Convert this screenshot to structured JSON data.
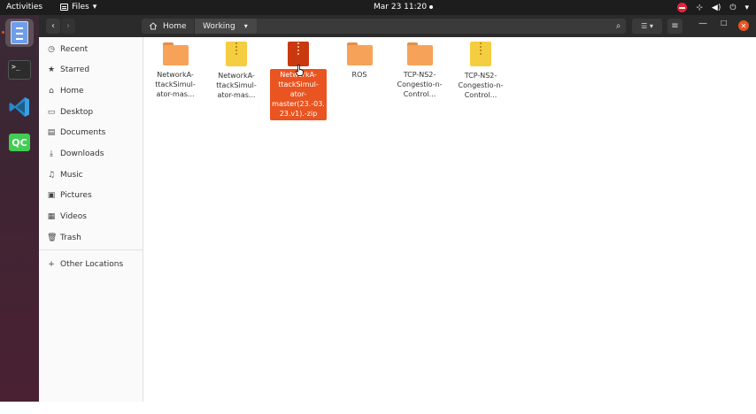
{
  "topbar": {
    "activities": "Activities",
    "app_name": "Files",
    "app_menu_arrow": "▾",
    "clock": "Mar 23  11:20",
    "tray_network": "⊹",
    "tray_volume": "◀)",
    "tray_power": "⏻",
    "tray_menu_arrow": "▾"
  },
  "dock": {
    "apps": [
      {
        "name": "Files",
        "icon": "files-icon"
      },
      {
        "name": "Terminal",
        "icon": "terminal-icon",
        "glyph": ">_"
      },
      {
        "name": "Visual Studio Code",
        "icon": "vscode-icon"
      },
      {
        "name": "Qt Creator",
        "icon": "qt-creator-icon",
        "glyph": "QC"
      }
    ],
    "show_apps_glyph": "···"
  },
  "header": {
    "back_glyph": "‹",
    "forward_glyph": "›",
    "path": [
      "Home",
      "Working"
    ],
    "path_arrow": "▾",
    "search_glyph": "⌕",
    "view_glyph": "☰ ▾",
    "menu_glyph": "≡",
    "minimize_glyph": "—",
    "maximize_glyph": "□",
    "close_glyph": "✕"
  },
  "sidebar": {
    "items": [
      {
        "label": "Recent",
        "icon": "clock-icon",
        "glyph": "◷"
      },
      {
        "label": "Starred",
        "icon": "star-icon",
        "glyph": "★"
      },
      {
        "label": "Home",
        "icon": "home-icon",
        "glyph": "⌂"
      },
      {
        "label": "Desktop",
        "icon": "desktop-icon",
        "glyph": "▭"
      },
      {
        "label": "Documents",
        "icon": "documents-icon",
        "glyph": "▤"
      },
      {
        "label": "Downloads",
        "icon": "downloads-icon",
        "glyph": "⤓"
      },
      {
        "label": "Music",
        "icon": "music-icon",
        "glyph": "♫"
      },
      {
        "label": "Pictures",
        "icon": "pictures-icon",
        "glyph": "▣"
      },
      {
        "label": "Videos",
        "icon": "videos-icon",
        "glyph": "▦"
      },
      {
        "label": "Trash",
        "icon": "trash-icon",
        "glyph": "🗑"
      }
    ],
    "other_locations": {
      "label": "Other Locations",
      "glyph": "+"
    }
  },
  "files": [
    {
      "label": "NetworkA-ttackSimul-ator-mas...",
      "type": "folder",
      "selected": false
    },
    {
      "label": "NetworkA-ttackSimul-ator-mas...",
      "type": "zip",
      "selected": false
    },
    {
      "label": "NetworkA-ttackSimul-ator-master(23.-03.23.v1).-zip",
      "type": "zip",
      "selected": true
    },
    {
      "label": "ROS",
      "type": "folder",
      "selected": false
    },
    {
      "label": "TCP-NS2-Congestio-n-Control...",
      "type": "folder",
      "selected": false
    },
    {
      "label": "TCP-NS2-Congestio-n-Control...",
      "type": "zip",
      "selected": false
    }
  ],
  "colors": {
    "accent": "#e95420",
    "folder": "#f6a359",
    "zip": "#f5cd40",
    "topbar": "#1d1d1d",
    "headerbar": "#2b2b2b"
  }
}
